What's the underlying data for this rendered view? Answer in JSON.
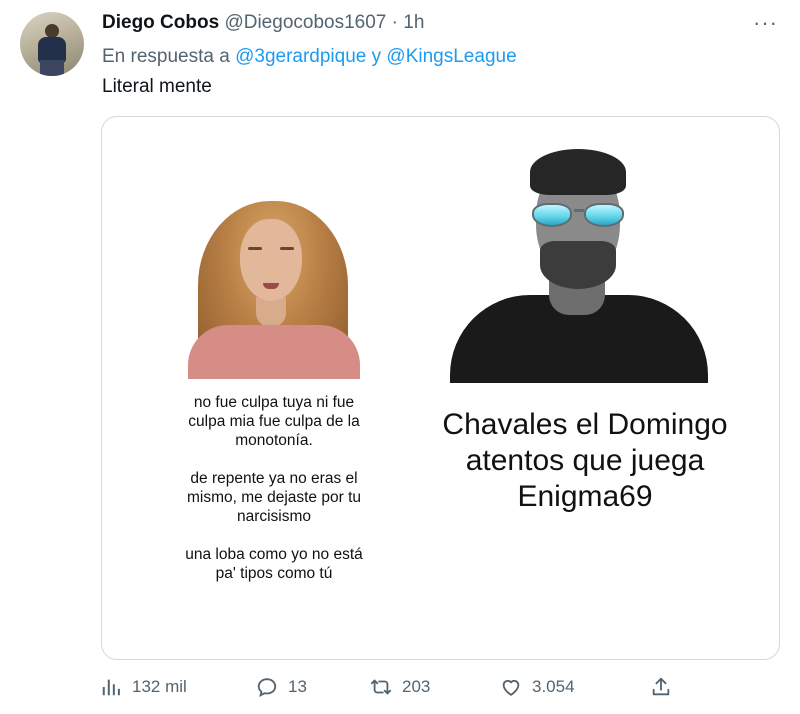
{
  "tweet": {
    "display_name": "Diego Cobos",
    "handle": "@Diegocobos1607",
    "separator": "·",
    "time": "1h",
    "reply_prefix": "En respuesta a",
    "reply_user_1": "@3gerardpique",
    "reply_joiner": "y",
    "reply_user_2": "@KingsLeague",
    "text": "Literal mente"
  },
  "media": {
    "left_caption": [
      "no fue culpa tuya ni fue culpa mia fue culpa de la monotonía.",
      "de repente ya no eras el mismo, me dejaste por tu narcisismo",
      "una loba como yo no está pa' tipos como tú"
    ],
    "right_caption": "Chavales el Domingo atentos que juega Enigma69"
  },
  "actions": {
    "views": "132 mil",
    "replies": "13",
    "retweets": "203",
    "likes": "3.054"
  },
  "icons": [
    "more-icon",
    "views-icon",
    "reply-icon",
    "retweet-icon",
    "like-icon",
    "share-icon"
  ],
  "colors": {
    "link": "#1d9bf0",
    "secondary": "#536471",
    "primary": "#0f1419"
  }
}
